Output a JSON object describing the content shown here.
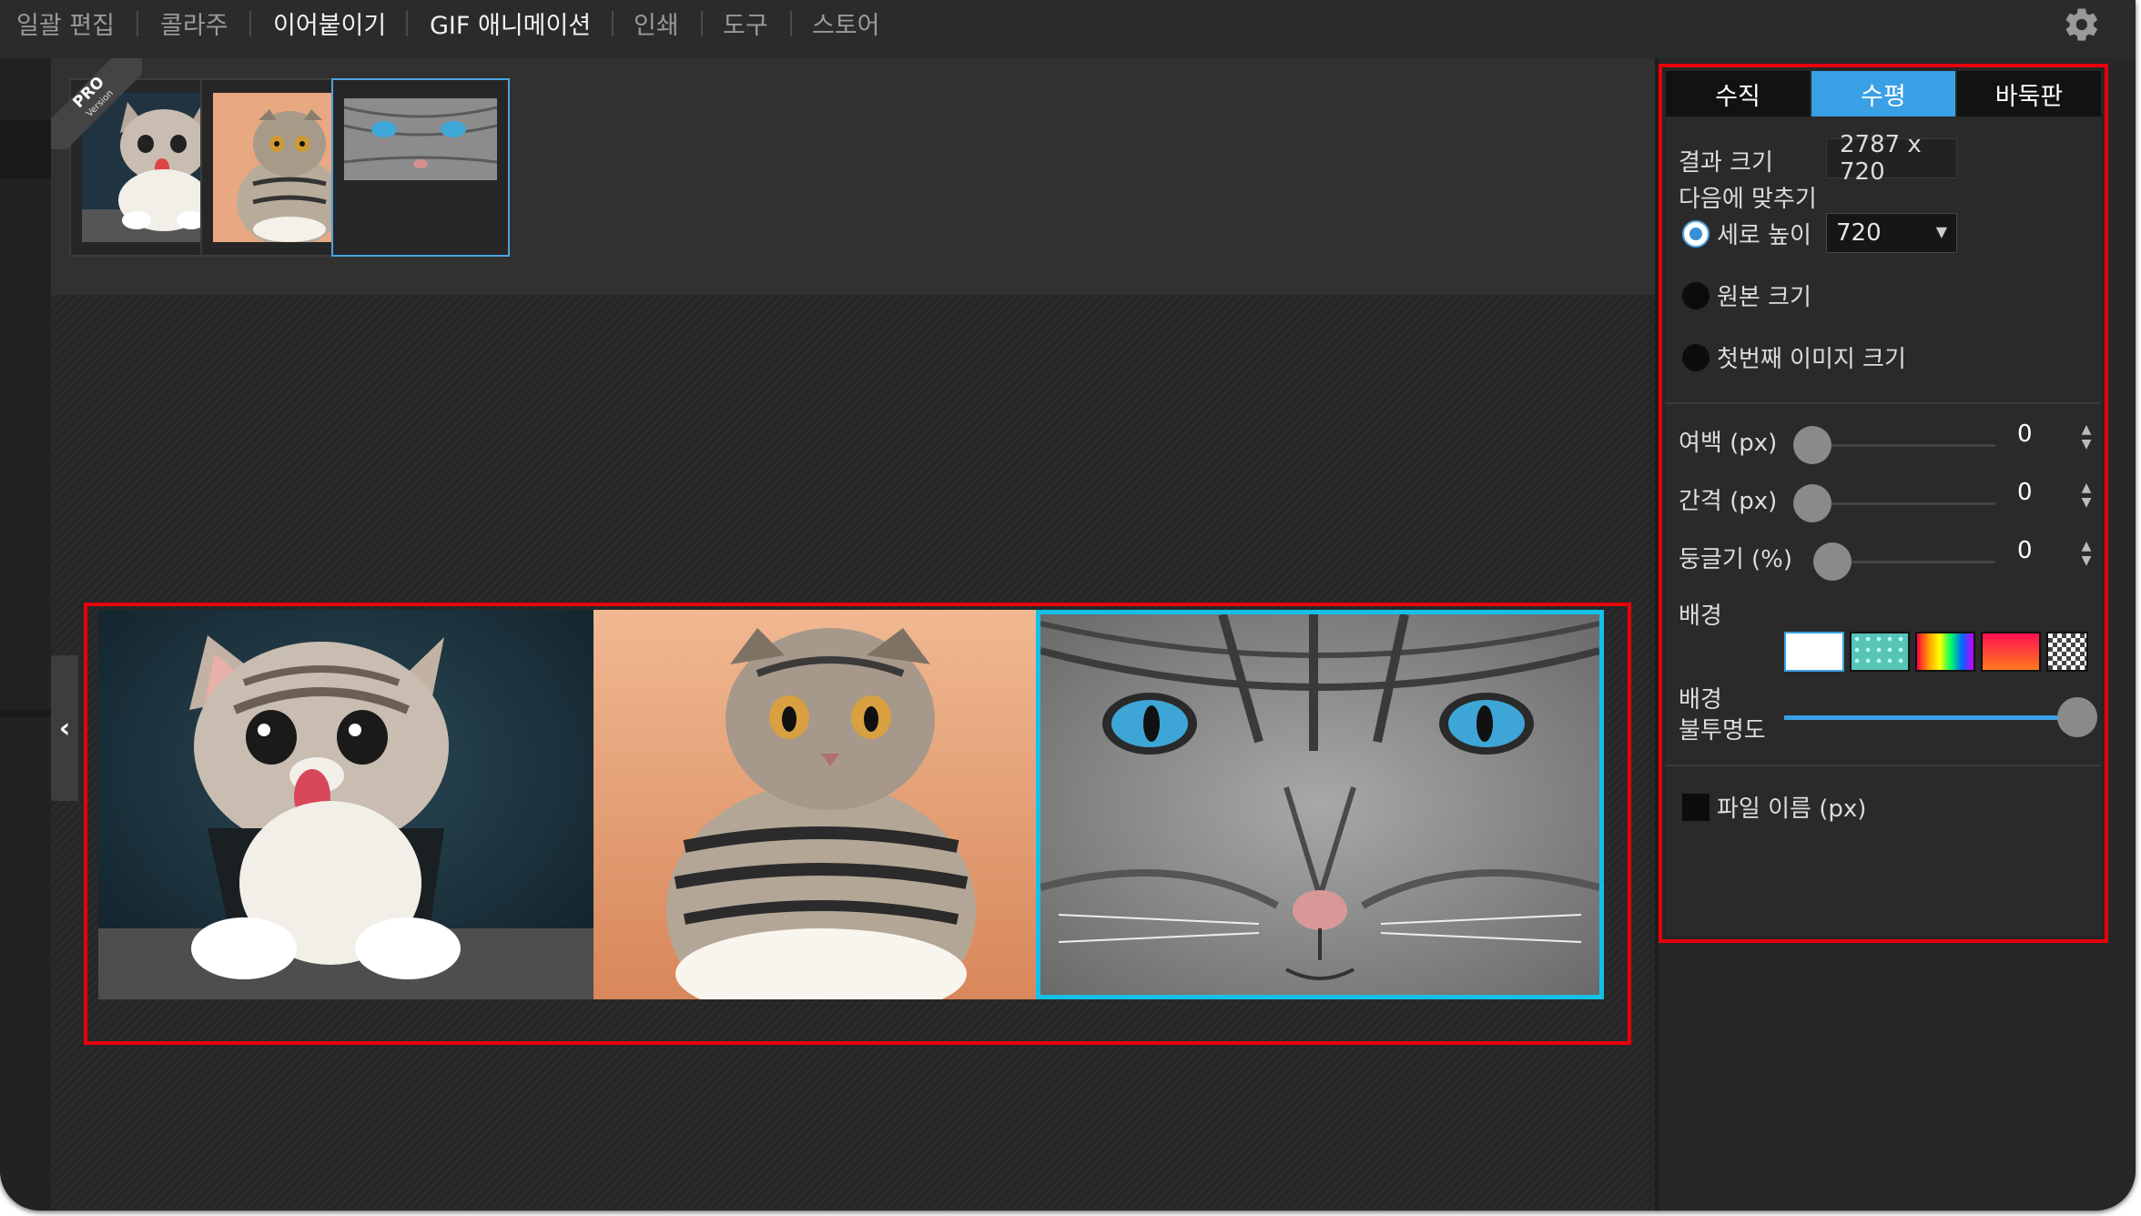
{
  "menu": {
    "items": [
      {
        "label": "일괄 편집",
        "active": false
      },
      {
        "label": "콜라주",
        "active": false
      },
      {
        "label": "이어붙이기",
        "active": true
      },
      {
        "label": "GIF 애니메이션",
        "active": true
      },
      {
        "label": "인쇄",
        "active": false
      },
      {
        "label": "도구",
        "active": false
      },
      {
        "label": "스토어",
        "active": false
      }
    ],
    "settings_icon": "gear-icon"
  },
  "thumbnails": {
    "badge": {
      "title": "PRO",
      "subtitle": "Version"
    },
    "items": [
      {
        "name": "cat-tongue",
        "selected": false
      },
      {
        "name": "cat-scottish-fold",
        "selected": false
      },
      {
        "name": "cat-blue-eyes",
        "selected": true
      }
    ]
  },
  "canvas": {
    "collapse_icon": "chevron-left-icon",
    "images": [
      "cat-tongue",
      "cat-scottish-fold",
      "cat-blue-eyes"
    ]
  },
  "panel": {
    "tabs": [
      {
        "label": "수직",
        "active": false
      },
      {
        "label": "수평",
        "active": true
      },
      {
        "label": "바둑판",
        "active": false
      }
    ],
    "result_size_label": "결과 크기",
    "result_size_value": "2787 x 720",
    "fit_to_label": "다음에 맞추기",
    "fit_options": [
      {
        "label": "세로 높이",
        "selected": true
      },
      {
        "label": "원본 크기",
        "selected": false
      },
      {
        "label": "첫번째 이미지 크기",
        "selected": false
      }
    ],
    "height_select_value": "720",
    "margin": {
      "label": "여백 (px)",
      "value": "0"
    },
    "spacing": {
      "label": "간격 (px)",
      "value": "0"
    },
    "roundness": {
      "label": "둥글기 (%)",
      "value": "0"
    },
    "background_label": "배경",
    "background_swatches": [
      "white",
      "teal-dots",
      "rainbow",
      "red-orange-gradient",
      "transparent-checker"
    ],
    "background_opacity_label_1": "배경",
    "background_opacity_label_2": "불투명도",
    "background_opacity_level": 1.0,
    "filename_label": "파일 이름 (px)",
    "filename_checked": false
  },
  "colors": {
    "accent_blue": "#3aa0e6",
    "highlight_red": "#e8000b",
    "selection_cyan": "#15c0e8"
  }
}
